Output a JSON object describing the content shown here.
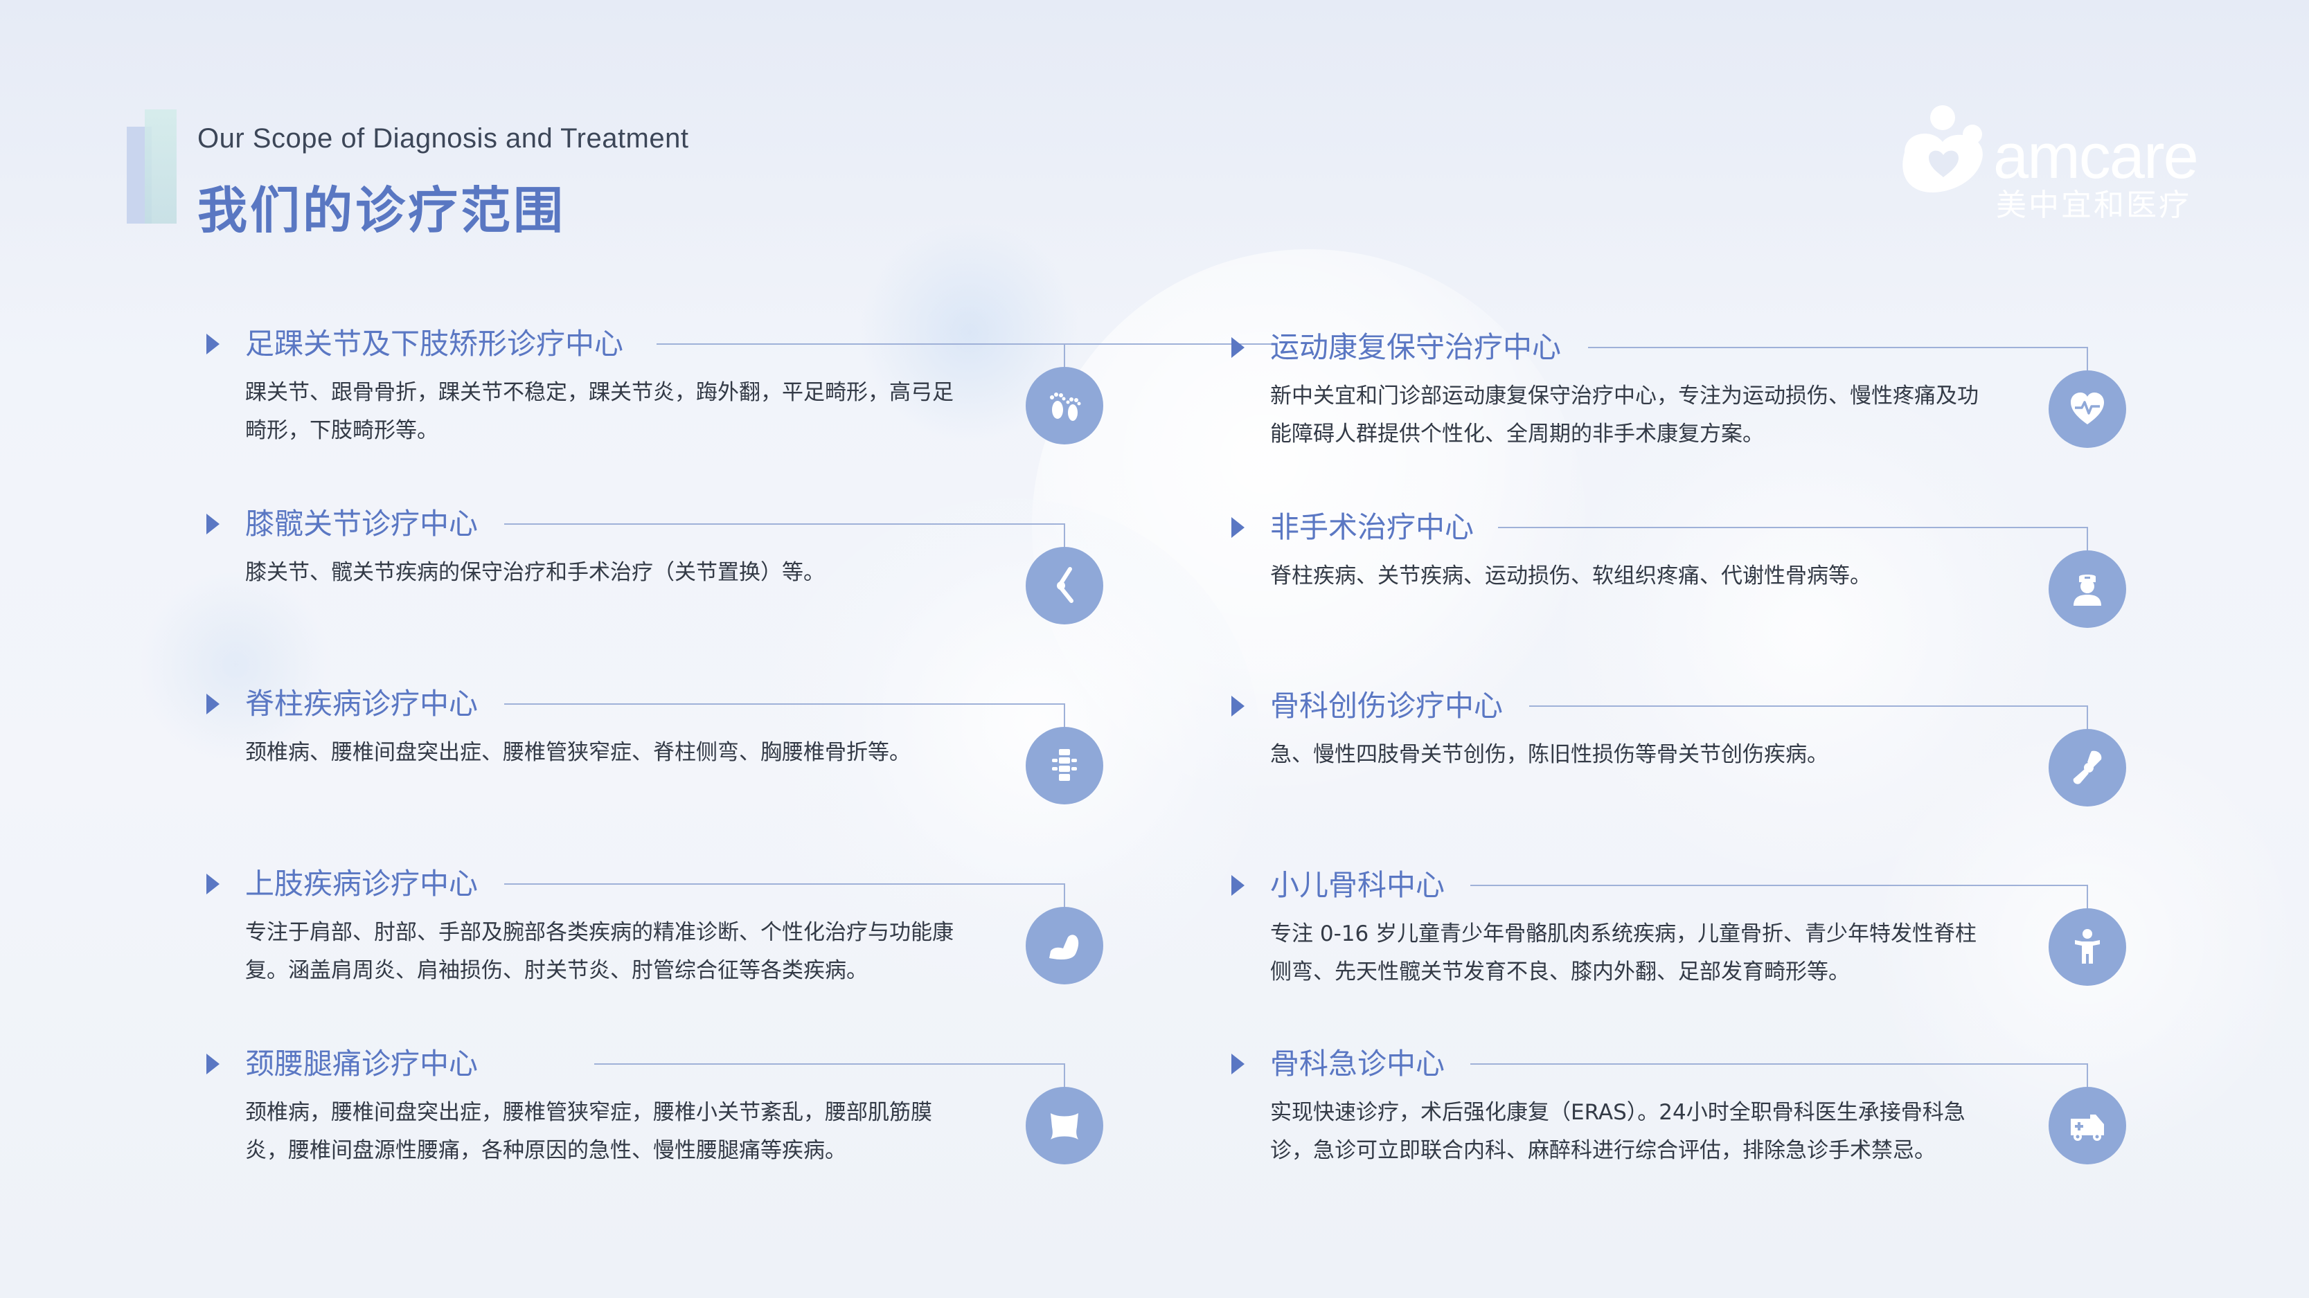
{
  "header": {
    "title_en": "Our Scope of Diagnosis and Treatment",
    "title_zh": "我们的诊疗范围"
  },
  "logo": {
    "brand": "amcare",
    "brand_zh": "美中宜和医疗"
  },
  "colors": {
    "accent": "#5a77c3",
    "icon_bg": "#8fa8d8",
    "line": "#9fb1d8",
    "body_text": "#333a46"
  },
  "left_items": [
    {
      "title": "足踝关节及下肢矫形诊疗中心",
      "desc": "踝关节、跟骨骨折，踝关节不稳定，踝关节炎，踇外翻，平足畸形，高弓足畸形，下肢畸形等。",
      "icon": "feet-icon"
    },
    {
      "title": "膝髋关节诊疗中心",
      "desc": "膝关节、髋关节疾病的保守治疗和手术治疗（关节置换）等。",
      "icon": "knee-icon"
    },
    {
      "title": "脊柱疾病诊疗中心",
      "desc": "颈椎病、腰椎间盘突出症、腰椎管狭窄症、脊柱侧弯、胸腰椎骨折等。",
      "icon": "spine-icon"
    },
    {
      "title": "上肢疾病诊疗中心",
      "desc": "专注于肩部、肘部、手部及腕部各类疾病的精准诊断、个性化治疗与功能康复。涵盖肩周炎、肩袖损伤、肘关节炎、肘管综合征等各类疾病。",
      "icon": "arm-icon"
    },
    {
      "title": "颈腰腿痛诊疗中心",
      "desc": "颈椎病，腰椎间盘突出症，腰椎管狭窄症，腰椎小关节紊乱，腰部肌筋膜炎，腰椎间盘源性腰痛，各种原因的急性、慢性腰腿痛等疾病。",
      "icon": "waist-icon"
    }
  ],
  "right_items": [
    {
      "title": "运动康复保守治疗中心",
      "desc": "新中关宜和门诊部运动康复保守治疗中心，专注为运动损伤、慢性疼痛及功能障碍人群提供个性化、全周期的非手术康复方案。",
      "icon": "heart-pulse-icon"
    },
    {
      "title": "非手术治疗中心",
      "desc": "脊柱疾病、关节疾病、运动损伤、软组织疼痛、代谢性骨病等。",
      "icon": "doctor-icon"
    },
    {
      "title": "骨科创伤诊疗中心",
      "desc": "急、慢性四肢骨关节创伤，陈旧性损伤等骨关节创伤疾病。",
      "icon": "bone-joint-icon"
    },
    {
      "title": "小儿骨科中心",
      "desc": "专注 0-16 岁儿童青少年骨骼肌肉系统疾病，儿童骨折、青少年特发性脊柱侧弯、先天性髋关节发育不良、膝内外翻、足部发育畸形等。",
      "icon": "child-icon"
    },
    {
      "title": "骨科急诊中心",
      "desc": "实现快速诊疗，术后强化康复（ERAS）。24小时全职骨科医生承接骨科急诊，急诊可立即联合内科、麻醉科进行综合评估，排除急诊手术禁忌。",
      "icon": "ambulance-icon"
    }
  ]
}
